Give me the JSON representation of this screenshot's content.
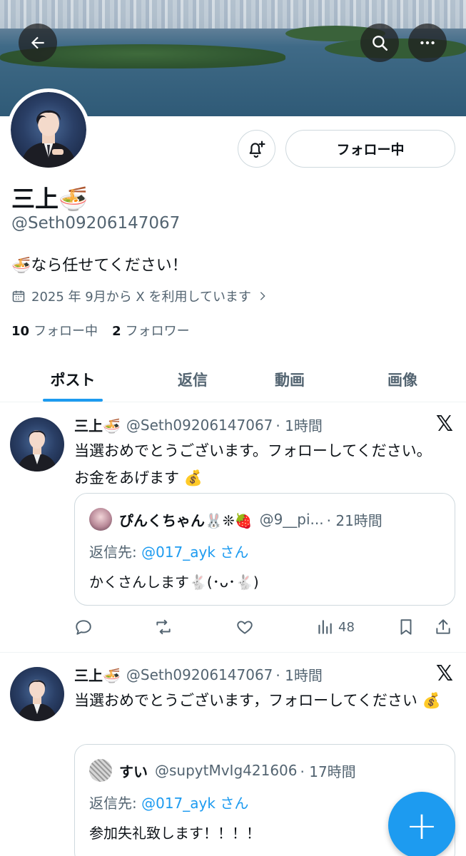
{
  "profile": {
    "name": "三上🍜",
    "handle": "@Seth09206147067",
    "bio": "🍜なら任せてください！",
    "joined": "2025 年 9月から X を利用しています",
    "following_count": "10",
    "following_label": "フォロー中",
    "followers_count": "2",
    "followers_label": "フォロワー",
    "follow_button_label": "フォロー中"
  },
  "header": {
    "back_icon": "arrow-left-icon",
    "search_icon": "search-icon",
    "more_icon": "more-icon"
  },
  "tabs": [
    {
      "label": "ポスト",
      "active": true
    },
    {
      "label": "返信"
    },
    {
      "label": "動画"
    },
    {
      "label": "画像"
    }
  ],
  "posts": [
    {
      "author": "三上🍜",
      "handle": "@Seth09206147067",
      "time": "· 1時間",
      "text": "当選おめでとうございます。フォローしてください。お金をあげます 💰",
      "quote": {
        "author": "ぴんくちゃん🐰❊🍓",
        "handle": "@9__pi...",
        "time": "· 21時間",
        "reply_prefix": "返信先: ",
        "reply_to": "@017_ayk さん",
        "text": "かくさんします🐇(･ᴗ･🐇)"
      },
      "views": "48"
    },
    {
      "author": "三上🍜",
      "handle": "@Seth09206147067",
      "time": "· 1時間",
      "text": "当選おめでとうございます，フォローしてください 💰",
      "quote": {
        "author": "すい",
        "handle": "@supytMvIg421606",
        "time": "· 17時間",
        "reply_prefix": "返信先: ",
        "reply_to": "@017_ayk さん",
        "text": "参加失礼致します！！！！"
      }
    }
  ],
  "fab_label": "+",
  "x_logo": "𝕏",
  "colors": {
    "accent": "#1d9bf0",
    "text": "#0f1419",
    "muted": "#536471",
    "border": "#cfd9de"
  }
}
